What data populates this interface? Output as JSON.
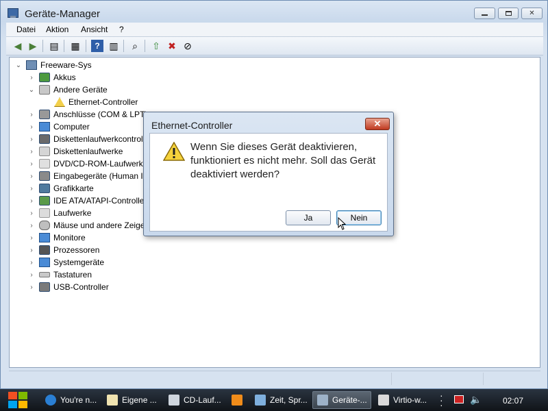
{
  "window": {
    "title": "Geräte-Manager",
    "menu": [
      "Datei",
      "Aktion",
      "Ansicht",
      "?"
    ]
  },
  "toolbar": {
    "icons": [
      "back-arrow-icon",
      "forward-arrow-icon",
      "console-tree-icon",
      "properties-icon",
      "help-icon",
      "action-pane-icon",
      "scan-hardware-icon",
      "update-driver-icon",
      "uninstall-icon",
      "disable-icon"
    ]
  },
  "tree": {
    "root": "Freeware-Sys",
    "items": [
      {
        "label": "Akkus",
        "expanded": false
      },
      {
        "label": "Andere Geräte",
        "expanded": true
      },
      {
        "label": "Ethernet-Controller",
        "child": true
      },
      {
        "label": "Anschlüsse (COM & LPT)",
        "expanded": false
      },
      {
        "label": "Computer",
        "expanded": false
      },
      {
        "label": "Diskettenlaufwerkcontroller",
        "expanded": false
      },
      {
        "label": "Diskettenlaufwerke",
        "expanded": false
      },
      {
        "label": "DVD/CD-ROM-Laufwerke",
        "expanded": false
      },
      {
        "label": "Eingabegeräte (Human Interface Devices)",
        "expanded": false
      },
      {
        "label": "Grafikkarte",
        "expanded": false
      },
      {
        "label": "IDE ATA/ATAPI-Controller",
        "expanded": false
      },
      {
        "label": "Laufwerke",
        "expanded": false
      },
      {
        "label": "Mäuse und andere Zeigegeräte",
        "expanded": false
      },
      {
        "label": "Monitore",
        "expanded": false
      },
      {
        "label": "Prozessoren",
        "expanded": false
      },
      {
        "label": "Systemgeräte",
        "expanded": false
      },
      {
        "label": "Tastaturen",
        "expanded": false
      },
      {
        "label": "USB-Controller",
        "expanded": false
      }
    ]
  },
  "dialog": {
    "title": "Ethernet-Controller",
    "message": "Wenn Sie dieses Gerät deaktivieren, funktioniert es nicht mehr. Soll das Gerät deaktiviert werden?",
    "yes": "Ja",
    "no": "Nein"
  },
  "taskbar": {
    "items": [
      {
        "label": "You're n...",
        "icon": "internet-explorer-icon"
      },
      {
        "label": "Eigene ...",
        "icon": "folder-icon"
      },
      {
        "label": "CD-Lauf...",
        "icon": "cd-drive-icon"
      },
      {
        "label": "",
        "icon": "media-player-icon"
      },
      {
        "label": "Zeit, Spr...",
        "icon": "control-panel-icon"
      },
      {
        "label": "Geräte-...",
        "icon": "device-manager-icon"
      },
      {
        "label": "Virtio-w...",
        "icon": "installer-icon"
      }
    ],
    "clock": "02:07"
  },
  "colors": {
    "window_frame": "#6d8cb2",
    "taskbar": "#1a2028",
    "dialog_close": "#c0391f",
    "warning": "#f3d04b"
  }
}
